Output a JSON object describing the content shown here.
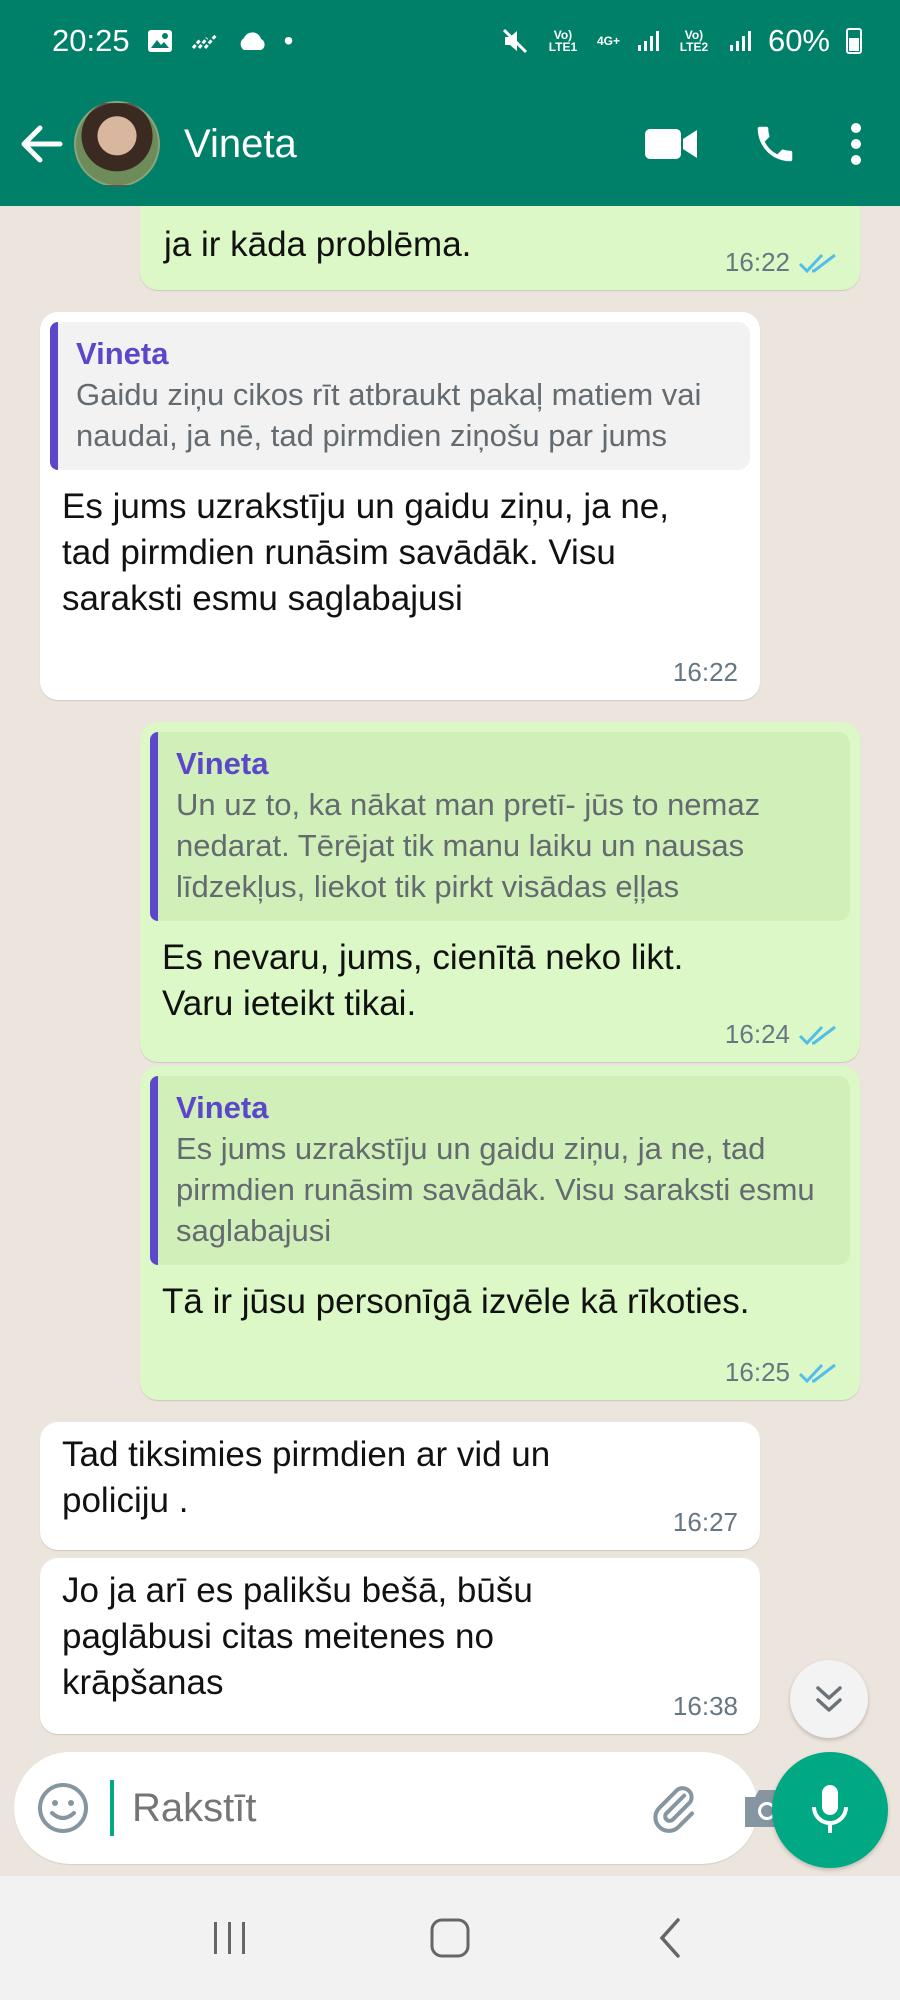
{
  "status": {
    "time": "20:25",
    "lte1": "Vo) LTE1",
    "net": "4G+",
    "lte2": "Vo) LTE2",
    "battery": "60%"
  },
  "header": {
    "contact_name": "Vineta",
    "icons": [
      "back-arrow-icon",
      "video-call-icon",
      "phone-icon",
      "more-vert-icon"
    ],
    "color": "#008069"
  },
  "messages": [
    {
      "dir": "out",
      "text": "ja ir kāda problēma.",
      "time": "16:22",
      "read": true
    },
    {
      "dir": "in",
      "quote_name": "Vineta",
      "quote_text": "Gaidu ziņu cikos rīt atbraukt pakaļ matiem vai naudai, ja nē, tad pirmdien ziņošu par jums",
      "text": "Es jums uzrakstīju un gaidu ziņu, ja ne, tad pirmdien runāsim savādāk. Visu saraksti esmu saglabajusi",
      "time": "16:22"
    },
    {
      "dir": "out",
      "quote_name": "Vineta",
      "quote_text": "Un uz to, ka nākat man pretī- jūs to nemaz nedarat.  Tērējat tik manu laiku un nausas līdzekļus, liekot tik pirkt visādas eļļas",
      "text": "Es nevaru, jums, cienītā neko likt. Varu ieteikt  tikai.",
      "time": "16:24",
      "read": true
    },
    {
      "dir": "out",
      "quote_name": "Vineta",
      "quote_text": "Es jums uzrakstīju un gaidu ziņu, ja ne, tad pirmdien runāsim savādāk.  Visu saraksti esmu saglabajusi",
      "text": "Tā ir jūsu personīgā izvēle kā rīkoties.",
      "time": "16:25",
      "read": true
    },
    {
      "dir": "in",
      "text": "Tad tiksimies pirmdien ar  vid un policiju .",
      "time": "16:27"
    },
    {
      "dir": "in",
      "text": "Jo ja arī es palikšu bešā, būšu paglābusi citas meitenes no krāpšanas",
      "time": "16:38"
    }
  ],
  "composer": {
    "placeholder": "Rakstīt",
    "icons": [
      "emoji-icon",
      "attach-icon",
      "camera-icon",
      "mic-icon"
    ]
  },
  "colors": {
    "accent": "#00a884",
    "outgoing_bubble": "#dcf8c6",
    "quote_name": "#5b47c9",
    "tick_read": "#53bdeb"
  }
}
